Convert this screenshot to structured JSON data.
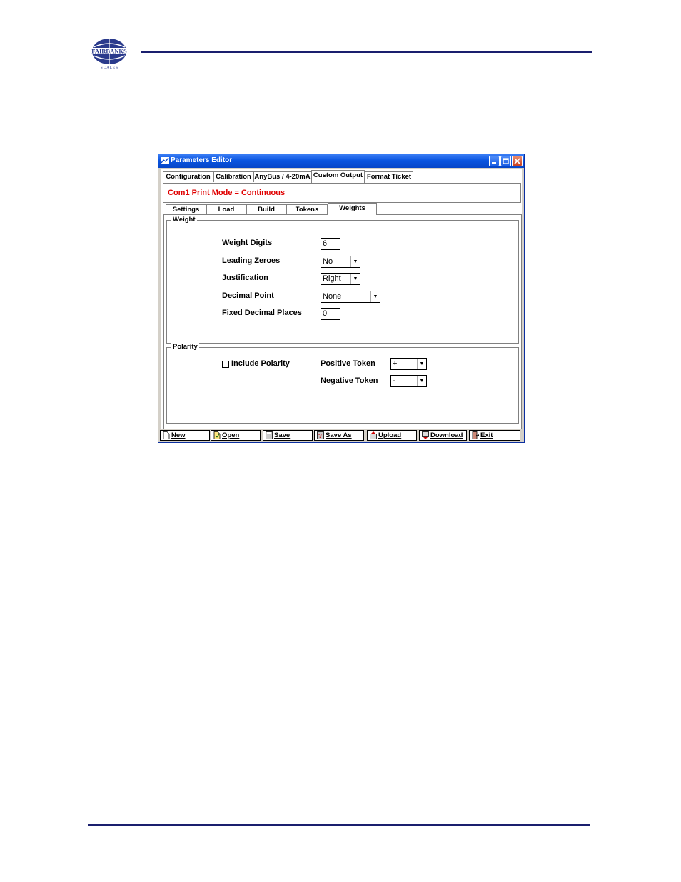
{
  "window": {
    "title": "Parameters Editor",
    "tabs": [
      {
        "label": "Configuration"
      },
      {
        "label": "Calibration"
      },
      {
        "label": "AnyBus / 4-20mA"
      },
      {
        "label": "Custom Output"
      },
      {
        "label": "Format Ticket"
      }
    ],
    "mode_text": "Com1 Print Mode = Continuous",
    "subtabs": [
      {
        "label": "Settings"
      },
      {
        "label": "Load"
      },
      {
        "label": "Build"
      },
      {
        "label": "Tokens"
      },
      {
        "label": "Weights"
      }
    ],
    "weight_group": {
      "legend": "Weight",
      "weight_digits_label": "Weight Digits",
      "weight_digits_value": "6",
      "leading_zeroes_label": "Leading Zeroes",
      "leading_zeroes_value": "No",
      "justification_label": "Justification",
      "justification_value": "Right",
      "decimal_point_label": "Decimal Point",
      "decimal_point_value": "None",
      "fixed_decimal_label": "Fixed Decimal Places",
      "fixed_decimal_value": "0"
    },
    "polarity_group": {
      "legend": "Polarity",
      "include_polarity_label": "Include Polarity",
      "positive_token_label": "Positive Token",
      "positive_token_value": "+",
      "negative_token_label": "Negative Token",
      "negative_token_value": "-"
    },
    "buttons": [
      {
        "label": "New"
      },
      {
        "label": "Open"
      },
      {
        "label": "Save"
      },
      {
        "label": "Save As"
      },
      {
        "label": "Upload"
      },
      {
        "label": "Download"
      },
      {
        "label": "Exit"
      }
    ]
  }
}
